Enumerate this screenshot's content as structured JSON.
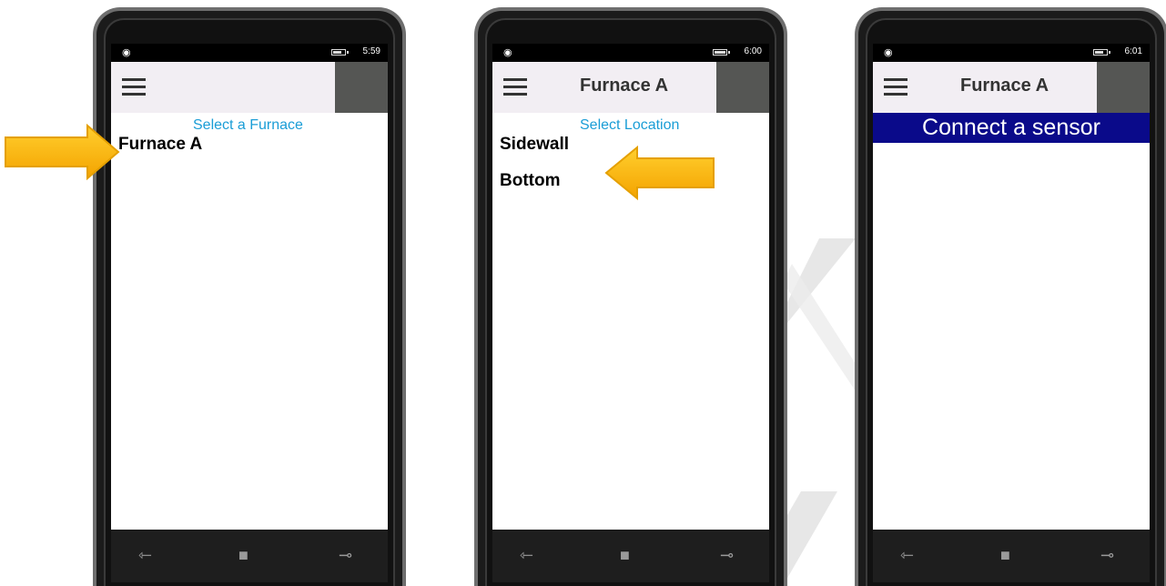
{
  "screens": [
    {
      "status": {
        "time": "5:59"
      },
      "appbar": {
        "title": ""
      },
      "label": "Select a Furnace",
      "items": [
        "Furnace A"
      ]
    },
    {
      "status": {
        "time": "6:00"
      },
      "appbar": {
        "title": "Furnace A"
      },
      "label": "Select Location",
      "items": [
        "Sidewall",
        "Bottom"
      ]
    },
    {
      "status": {
        "time": "6:01"
      },
      "appbar": {
        "title": "Furnace A"
      },
      "banner": "Connect a sensor"
    }
  ],
  "colors": {
    "accent_label": "#1a9dd6",
    "banner_bg": "#0a0a8a",
    "appbar_bg": "#f2eef3",
    "arrow": "#ffc000"
  },
  "icons": {
    "menu": "hamburger-icon",
    "signal": "signal-icon",
    "battery": "battery-icon",
    "nav_back": "back-icon",
    "nav_home": "windows-icon",
    "nav_search": "search-icon"
  }
}
